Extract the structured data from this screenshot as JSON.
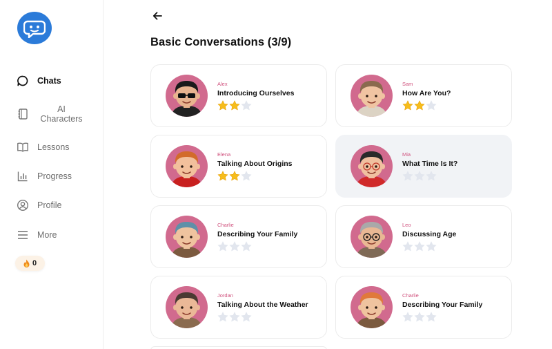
{
  "sidebar": {
    "logo_icon": "chat-bot-logo-icon",
    "items": [
      {
        "label": "Chats",
        "icon": "speech-bubble-icon",
        "active": true
      },
      {
        "label": "AI Characters",
        "icon": "notebook-icon",
        "active": false
      },
      {
        "label": "Lessons",
        "icon": "book-icon",
        "active": false
      },
      {
        "label": "Progress",
        "icon": "bar-chart-icon",
        "active": false
      },
      {
        "label": "Profile",
        "icon": "user-circle-icon",
        "active": false
      },
      {
        "label": "More",
        "icon": "hamburger-icon",
        "active": false
      }
    ],
    "streak": {
      "icon": "flame-icon",
      "count": "0"
    }
  },
  "header": {
    "back_icon": "arrow-left-icon",
    "title": "Basic Conversations (3/9)"
  },
  "cards": [
    {
      "character": "Alex",
      "lesson": "Introducing Ourselves",
      "stars": 2,
      "shirt": "#222222",
      "hair": "#1a1a1a",
      "skin": "#e9b48f",
      "glasses": "sun"
    },
    {
      "character": "Sam",
      "lesson": "How Are You?",
      "stars": 2,
      "shirt": "#dcd3c4",
      "hair": "#8a6a4e",
      "skin": "#f0c4a2",
      "glasses": "none"
    },
    {
      "character": "Elena",
      "lesson": "Talking About Origins",
      "stars": 2,
      "shirt": "#c8201f",
      "hair": "#d26b2b",
      "skin": "#f2c09c",
      "glasses": "none"
    },
    {
      "character": "Mia",
      "lesson": "What Time Is It?",
      "stars": 0,
      "shirt": "#d02a2a",
      "hair": "#2a2a2a",
      "skin": "#f0c0a0",
      "glasses": "round-red",
      "highlight": true
    },
    {
      "character": "Charlie",
      "lesson": "Describing Your Family",
      "stars": 0,
      "shirt": "#7b5a3f",
      "hair": "#5f90a8",
      "skin": "#efc39f",
      "glasses": "none"
    },
    {
      "character": "Leo",
      "lesson": "Discussing Age",
      "stars": 0,
      "shirt": "#7f6a56",
      "hair": "#a9a9a9",
      "skin": "#e9b894",
      "glasses": "round"
    },
    {
      "character": "Jordan",
      "lesson": "Talking About the Weather",
      "stars": 0,
      "shirt": "#8a6b4f",
      "hair": "#4a3a32",
      "skin": "#eab897",
      "glasses": "none"
    },
    {
      "character": "Charlie",
      "lesson": "Describing Your Family",
      "stars": 0,
      "shirt": "#7b5a3f",
      "hair": "#e0793b",
      "skin": "#efc39f",
      "glasses": "none"
    }
  ],
  "colors": {
    "accent": "#2b7bd9",
    "avatar_bg": "#d16a8e",
    "character_name": "#d0527e",
    "star_filled": "#f6bd1c",
    "star_empty": "#e2e6ee"
  }
}
